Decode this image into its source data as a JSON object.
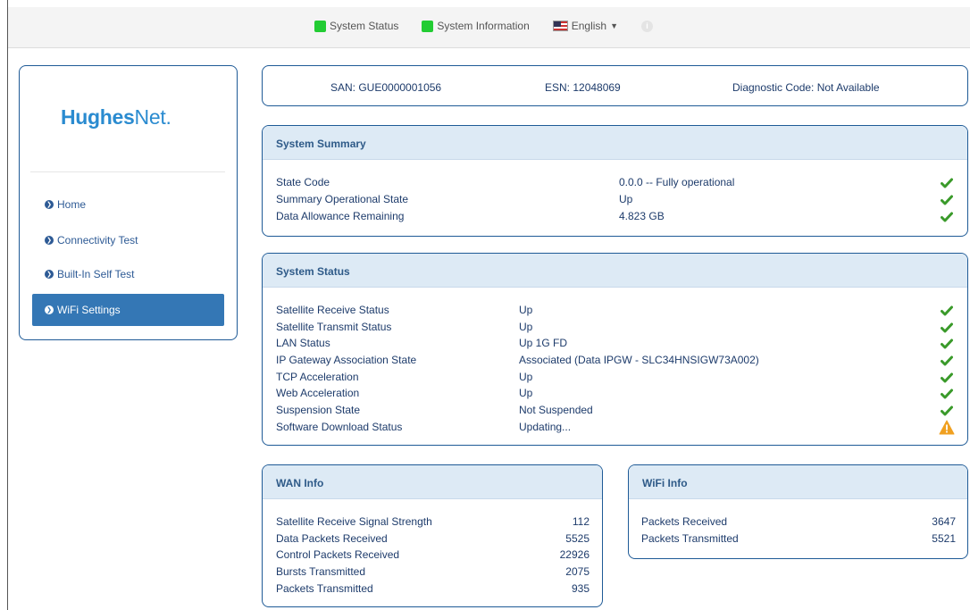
{
  "topnav": {
    "system_status": "System Status",
    "system_information": "System Information",
    "language": "English",
    "status_color": "#22cc33"
  },
  "sidebar": {
    "logo_bold": "Hughes",
    "logo_light": "Net",
    "logo_dot": ".",
    "items": [
      {
        "label": "Home"
      },
      {
        "label": "Connectivity Test"
      },
      {
        "label": "Built-In Self Test"
      },
      {
        "label": "WiFi Settings",
        "active": true
      }
    ]
  },
  "identity": {
    "san": "SAN: GUE0000001056",
    "esn": "ESN: 12048069",
    "diagnostic": "Diagnostic Code: Not Available"
  },
  "system_summary": {
    "title": "System Summary",
    "rows": [
      {
        "label": "State Code",
        "value": "0.0.0 -- Fully operational",
        "status": "check"
      },
      {
        "label": "Summary Operational State",
        "value": "Up",
        "status": "check"
      },
      {
        "label": "Data Allowance Remaining",
        "value": "4.823 GB",
        "status": "check"
      }
    ]
  },
  "system_status": {
    "title": "System Status",
    "rows": [
      {
        "label": "Satellite Receive Status",
        "value": "Up",
        "status": "check"
      },
      {
        "label": "Satellite Transmit Status",
        "value": "Up",
        "status": "check"
      },
      {
        "label": "LAN Status",
        "value": "Up 1G FD",
        "status": "check"
      },
      {
        "label": "IP Gateway Association State",
        "value": "Associated (Data IPGW - SLC34HNSIGW73A002)",
        "status": "check"
      },
      {
        "label": "TCP Acceleration",
        "value": "Up",
        "status": "check"
      },
      {
        "label": "Web Acceleration",
        "value": "Up",
        "status": "check"
      },
      {
        "label": "Suspension State",
        "value": "Not Suspended",
        "status": "check"
      },
      {
        "label": "Software Download Status",
        "value": "Updating...",
        "status": "warning"
      }
    ]
  },
  "wan_info": {
    "title": "WAN Info",
    "rows": [
      {
        "label": "Satellite Receive Signal Strength",
        "value": "112"
      },
      {
        "label": "Data Packets Received",
        "value": "5525"
      },
      {
        "label": "Control Packets Received",
        "value": "22926"
      },
      {
        "label": "Bursts Transmitted",
        "value": "2075"
      },
      {
        "label": "Packets Transmitted",
        "value": "935"
      }
    ]
  },
  "wifi_info": {
    "title": "WiFi Info",
    "rows": [
      {
        "label": "Packets Received",
        "value": "3647"
      },
      {
        "label": "Packets Transmitted",
        "value": "5521"
      }
    ]
  },
  "colors": {
    "check": "#3a9a2a",
    "warning": "#f0a020",
    "accent": "#3477b5",
    "border": "#1e5a96"
  }
}
